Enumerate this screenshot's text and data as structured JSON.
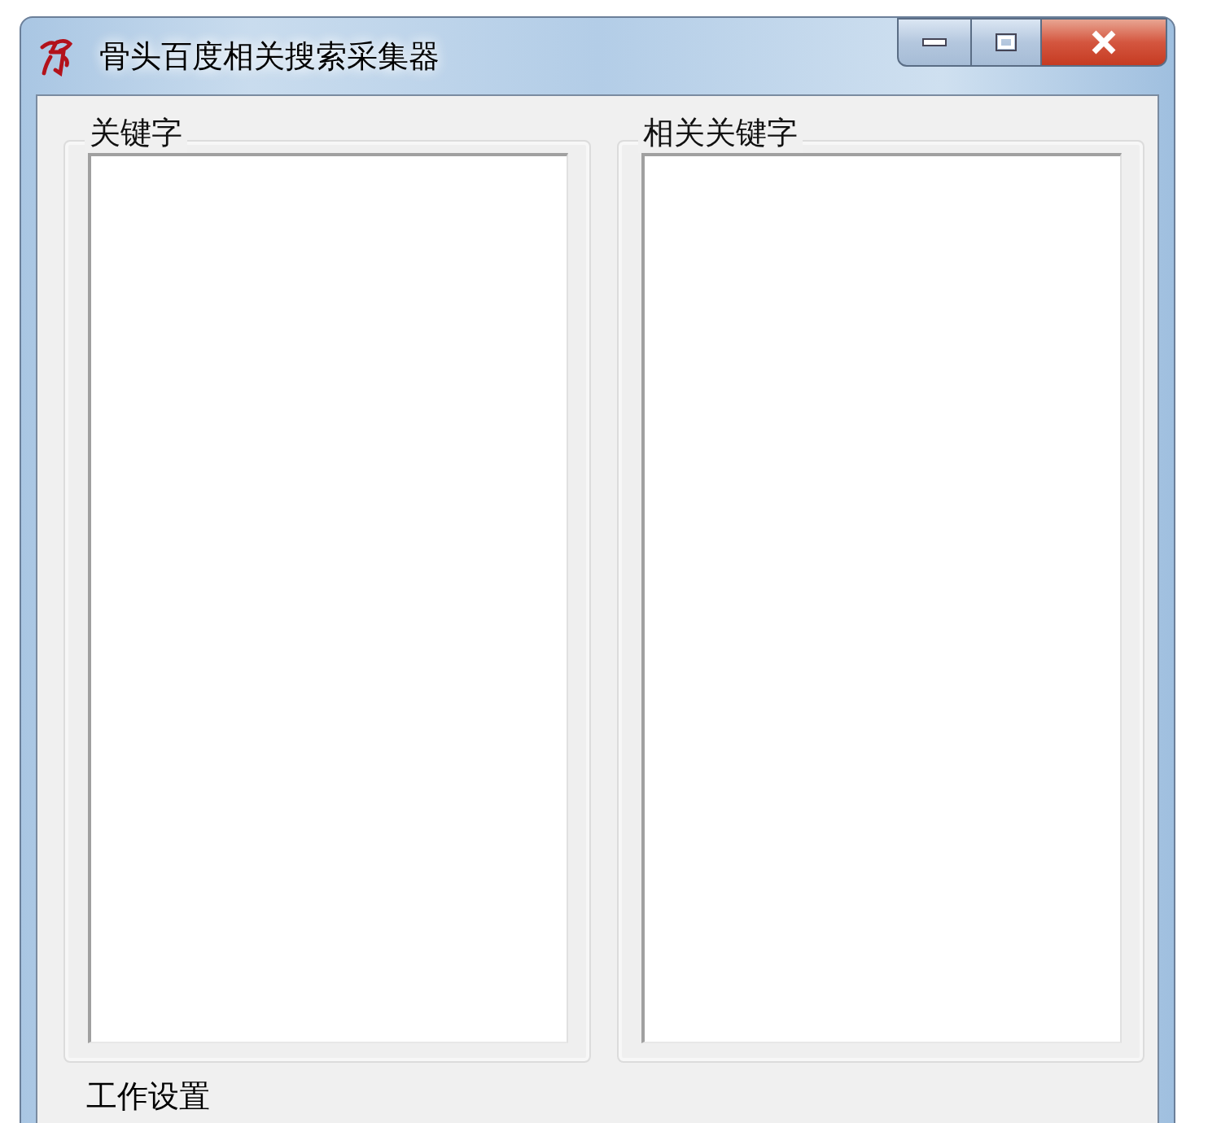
{
  "window": {
    "title": "骨头百度相关搜索采集器"
  },
  "groups": [
    {
      "label": "关键字"
    },
    {
      "label": "相关关键字"
    }
  ],
  "section": {
    "label": "工作设置"
  }
}
